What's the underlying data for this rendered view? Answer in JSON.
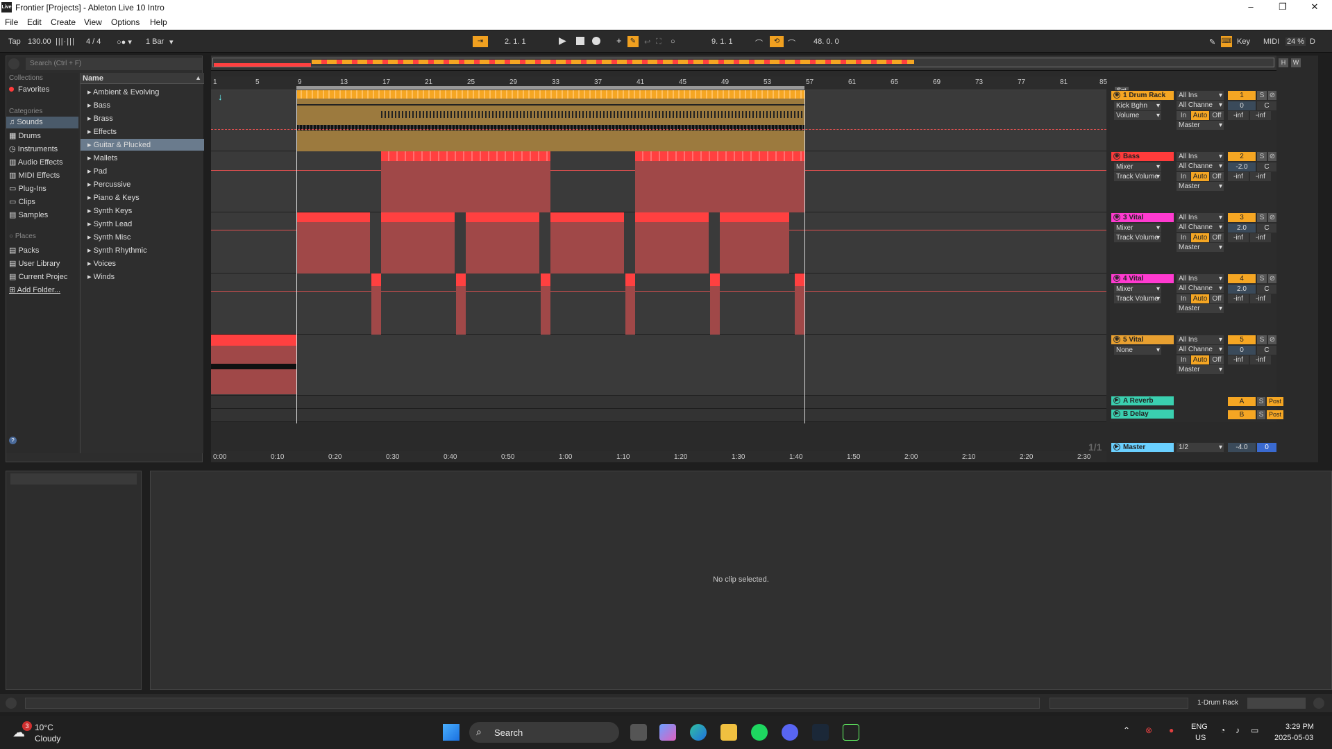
{
  "window": {
    "title": "Frontier  [Projects] - Ableton Live 10 Intro",
    "logo": "Live",
    "min": "–",
    "max": "❐",
    "close": "✕"
  },
  "menu": [
    "File",
    "Edit",
    "Create",
    "View",
    "Options",
    "Help"
  ],
  "transport": {
    "tap": "Tap",
    "tempo": "130.00",
    "time_sig": "4 / 4",
    "quant": "1 Bar",
    "arr_pos": "2.  1.  1",
    "loop_start": "9.  1.  1",
    "loop_len": "48.  0.  0",
    "key": "Key",
    "midi": "MIDI",
    "cpu": "24 %",
    "d": "D"
  },
  "browser": {
    "search_placeholder": "Search (Ctrl + F)",
    "collections_label": "Collections",
    "favorites": "Favorites",
    "categories_label": "Categories",
    "categories": [
      "Sounds",
      "Drums",
      "Instruments",
      "Audio Effects",
      "MIDI Effects",
      "Plug-Ins",
      "Clips",
      "Samples"
    ],
    "places_label": "Places",
    "places": [
      "Packs",
      "User Library",
      "Current Projec",
      "Add Folder..."
    ],
    "name_header": "Name",
    "items": [
      "Ambient & Evolving",
      "Bass",
      "Brass",
      "Effects",
      "Guitar & Plucked",
      "Mallets",
      "Pad",
      "Percussive",
      "Piano & Keys",
      "Synth Keys",
      "Synth Lead",
      "Synth Misc",
      "Synth Rhythmic",
      "Voices",
      "Winds"
    ]
  },
  "ruler": [
    "1",
    "5",
    "9",
    "13",
    "17",
    "21",
    "25",
    "29",
    "33",
    "37",
    "41",
    "45",
    "49",
    "53",
    "57",
    "61",
    "65",
    "69",
    "73",
    "77",
    "81",
    "85"
  ],
  "time_ruler": [
    "0:00",
    "0:10",
    "0:20",
    "0:30",
    "0:40",
    "0:50",
    "1:00",
    "1:10",
    "1:20",
    "1:30",
    "1:40",
    "1:50",
    "2:00",
    "2:10",
    "2:20",
    "2:30"
  ],
  "set_label": "Set",
  "hw": [
    "H",
    "W"
  ],
  "tracks": [
    {
      "name": "1 Drum Rack",
      "color": "#f5a623",
      "dev": "Kick Bghn",
      "param": "Volume",
      "input": "All Ins",
      "chan": "All Channe",
      "mon": [
        "In",
        "Auto",
        "Off"
      ],
      "out": "Master",
      "num": "1",
      "vol": "0",
      "pan": "C",
      "peak": [
        "-inf",
        "-inf"
      ]
    },
    {
      "name": "Bass",
      "color": "#ff3b3b",
      "dev": "Mixer",
      "param": "Track Volume",
      "input": "All Ins",
      "chan": "All Channe",
      "mon": [
        "In",
        "Auto",
        "Off"
      ],
      "out": "Master",
      "num": "2",
      "vol": "-2.0",
      "pan": "C",
      "peak": [
        "-inf",
        "-inf"
      ]
    },
    {
      "name": "3 Vital",
      "color": "#ff3ad0",
      "dev": "Mixer",
      "param": "Track Volume",
      "input": "All Ins",
      "chan": "All Channe",
      "mon": [
        "In",
        "Auto",
        "Off"
      ],
      "out": "Master",
      "num": "3",
      "vol": "2.0",
      "pan": "C",
      "peak": [
        "-inf",
        "-inf"
      ]
    },
    {
      "name": "4 Vital",
      "color": "#ff3ad0",
      "dev": "Mixer",
      "param": "Track Volume",
      "input": "All Ins",
      "chan": "All Channe",
      "mon": [
        "In",
        "Auto",
        "Off"
      ],
      "out": "Master",
      "num": "4",
      "vol": "2.0",
      "pan": "C",
      "peak": [
        "-inf",
        "-inf"
      ]
    },
    {
      "name": "5 Vital",
      "color": "#e8a030",
      "dev": "None",
      "param": "",
      "input": "All Ins",
      "chan": "All Channe",
      "mon": [
        "In",
        "Auto",
        "Off"
      ],
      "out": "Master",
      "num": "5",
      "vol": "0",
      "pan": "C",
      "peak": [
        "-inf",
        "-inf"
      ]
    }
  ],
  "returns": [
    {
      "name": "A Reverb",
      "letter": "A",
      "s": "S",
      "post": "Post"
    },
    {
      "name": "B Delay",
      "letter": "B",
      "s": "S",
      "post": "Post"
    }
  ],
  "master": {
    "name": "Master",
    "sel": "1/2",
    "vol": "-4.0",
    "pan": "0"
  },
  "fraction": "1/1",
  "detail": {
    "empty": "No clip selected."
  },
  "status": {
    "track": "1-Drum Rack"
  },
  "taskbar": {
    "temp": "10°C",
    "weather": "Cloudy",
    "badge": "3",
    "search": "Search",
    "lang": "ENG",
    "region": "US",
    "time": "3:29 PM",
    "date": "2025-05-03"
  }
}
